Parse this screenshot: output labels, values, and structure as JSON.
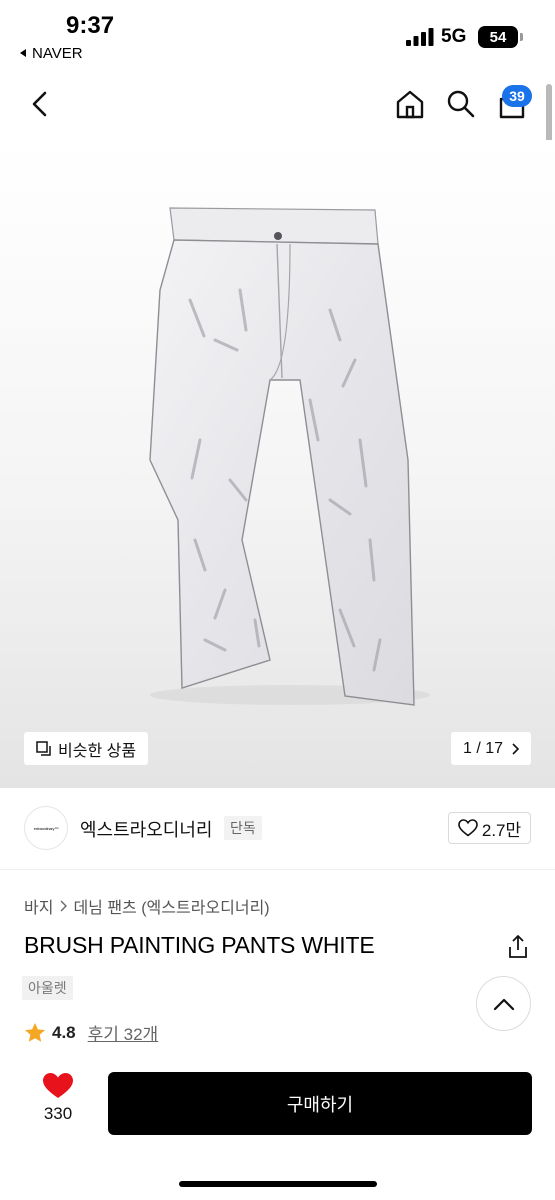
{
  "status_bar": {
    "time": "9:37",
    "back_app": "NAVER",
    "network": "5G",
    "battery": "54"
  },
  "nav": {
    "back_icon": "chevron-left-icon",
    "home_icon": "home-icon",
    "search_icon": "search-icon",
    "cart_icon": "cart-icon",
    "cart_count": "39"
  },
  "gallery": {
    "similar_label": "비슷한 상품",
    "pager": "1 / 17"
  },
  "brand": {
    "logo_text": "extraordinary™",
    "name": "엑스트라오디너리",
    "tag": "단독",
    "likes": "2.7만"
  },
  "product": {
    "breadcrumb": [
      "바지",
      "데님 팬츠 (엑스트라오디너리)"
    ],
    "title": "BRUSH PAINTING PANTS WHITE",
    "outlet_tag": "아울렛",
    "rating": "4.8",
    "reviews": "후기 32개"
  },
  "bottom": {
    "wish_count": "330",
    "buy_label": "구매하기"
  },
  "colors": {
    "badge": "#1a73e8",
    "wish_heart": "#e8121c",
    "star": "#f5a623",
    "buy_button": "#000000"
  }
}
